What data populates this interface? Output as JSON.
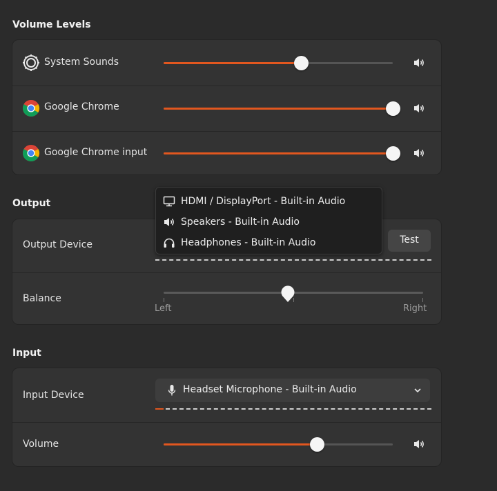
{
  "sections": {
    "volume_levels": "Volume Levels",
    "output": "Output",
    "input": "Input"
  },
  "volume_levels": {
    "rows": [
      {
        "label": "System Sounds",
        "icon": "system-sounds-icon",
        "level": 0.6
      },
      {
        "label": "Google Chrome",
        "icon": "chrome-icon",
        "level": 1.0
      },
      {
        "label": "Google Chrome input",
        "icon": "chrome-icon",
        "level": 1.0
      }
    ]
  },
  "output": {
    "device_label": "Output Device",
    "test_label": "Test",
    "balance_label": "Balance",
    "balance_left": "Left",
    "balance_right": "Right",
    "balance_value": 0.48,
    "menu_items": [
      {
        "label": "HDMI / DisplayPort - Built-in Audio",
        "icon": "monitor-icon"
      },
      {
        "label": "Speakers - Built-in Audio",
        "icon": "speaker-icon"
      },
      {
        "label": "Headphones - Built-in Audio",
        "icon": "headphones-icon"
      }
    ]
  },
  "input": {
    "device_label": "Input Device",
    "selected_device": "Headset Microphone - Built-in Audio",
    "volume_label": "Volume",
    "volume_level": 0.67
  },
  "colors": {
    "accent": "#e2571f",
    "background": "#2b2b2b",
    "card": "#333333"
  }
}
